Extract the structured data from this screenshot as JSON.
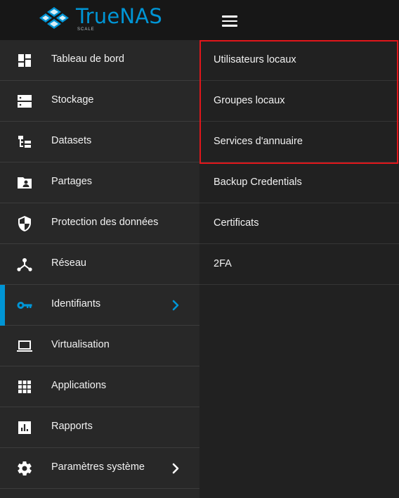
{
  "app": {
    "brand_name": "TrueNAS",
    "brand_sub": "SCALE",
    "colors": {
      "accent": "#0095d5",
      "highlight": "#e0161b"
    }
  },
  "sidebar": {
    "items": [
      {
        "label": "Tableau de bord",
        "icon": "dashboard-icon"
      },
      {
        "label": "Stockage",
        "icon": "storage-icon"
      },
      {
        "label": "Datasets",
        "icon": "datasets-icon"
      },
      {
        "label": "Partages",
        "icon": "shares-folder-icon"
      },
      {
        "label": "Protection des données",
        "icon": "security-shield-icon"
      },
      {
        "label": "Réseau",
        "icon": "network-icon"
      },
      {
        "label": "Identifiants",
        "icon": "key-icon",
        "active": true,
        "has_submenu": true
      },
      {
        "label": "Virtualisation",
        "icon": "laptop-icon"
      },
      {
        "label": "Applications",
        "icon": "apps-grid-icon"
      },
      {
        "label": "Rapports",
        "icon": "reports-chart-icon"
      },
      {
        "label": "Paramètres système",
        "icon": "gear-icon",
        "has_submenu": true
      }
    ]
  },
  "submenu": {
    "items": [
      {
        "label": "Utilisateurs locaux"
      },
      {
        "label": "Groupes locaux"
      },
      {
        "label": "Services d'annuaire"
      },
      {
        "label": "Backup Credentials"
      },
      {
        "label": "Certificats"
      },
      {
        "label": "2FA"
      }
    ]
  }
}
